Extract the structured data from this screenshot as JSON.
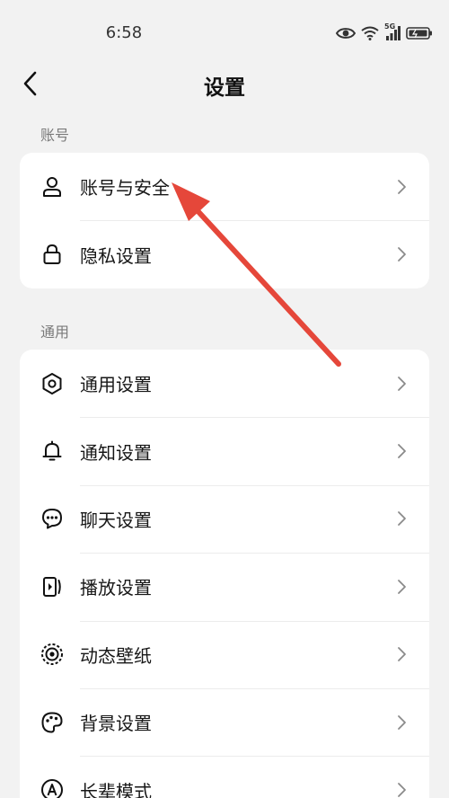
{
  "status_bar": {
    "time": "6:58",
    "network": "5G",
    "icons": [
      "eye-icon",
      "wifi-icon",
      "cellular-signal-icon",
      "battery-icon"
    ]
  },
  "nav": {
    "title": "设置",
    "back_icon": "chevron-left-icon"
  },
  "sections": {
    "account": {
      "title": "账号",
      "items": [
        {
          "label": "账号与安全",
          "icon": "user-icon"
        },
        {
          "label": "隐私设置",
          "icon": "lock-icon"
        }
      ]
    },
    "general": {
      "title": "通用",
      "items": [
        {
          "label": "通用设置",
          "icon": "gear-icon"
        },
        {
          "label": "通知设置",
          "icon": "bell-icon"
        },
        {
          "label": "聊天设置",
          "icon": "chat-bubble-icon"
        },
        {
          "label": "播放设置",
          "icon": "play-device-icon"
        },
        {
          "label": "动态壁纸",
          "icon": "live-wallpaper-icon"
        },
        {
          "label": "背景设置",
          "icon": "palette-icon"
        },
        {
          "label": "长辈模式",
          "icon": "elder-mode-icon"
        }
      ]
    }
  },
  "colors": {
    "background": "#f2f2f2",
    "card": "#ffffff",
    "annotation_arrow": "#e5473a",
    "section_title": "#7a7a7a"
  }
}
